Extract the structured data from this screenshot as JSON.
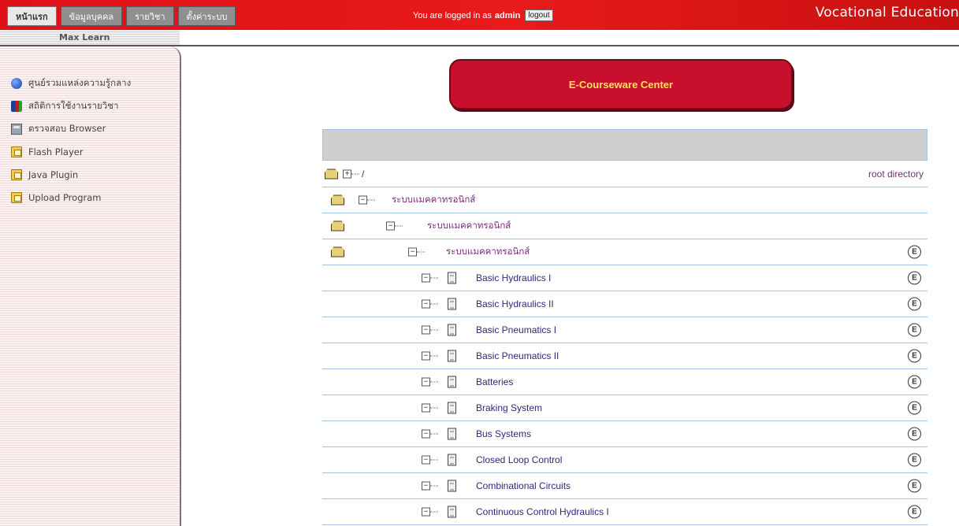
{
  "topbar": {
    "tabs": [
      "หน้าแรก",
      "ข้อมูลบุคคล",
      "รายวิชา",
      "ตั้งค่าระบบ"
    ],
    "login_prefix": "You are logged in as",
    "login_user": "admin",
    "logout_label": "logout",
    "brand": "Vocational Education"
  },
  "subbar": {
    "label": "Max Learn"
  },
  "sidebar": {
    "items": [
      {
        "label": "ศูนย์รวมแหล่งความรู้กลาง",
        "icon": "globe-icon"
      },
      {
        "label": "สถิติการใช้งานรายวิชา",
        "icon": "books-icon"
      },
      {
        "label": "ตรวจสอบ Browser",
        "icon": "calculator-icon"
      },
      {
        "label": "Flash Player",
        "icon": "folder-icon"
      },
      {
        "label": "Java Plugin",
        "icon": "folder-icon"
      },
      {
        "label": "Upload Program",
        "icon": "folder-icon"
      }
    ]
  },
  "main": {
    "center_button": "E-Courseware Center",
    "root": {
      "path": "/",
      "label": "root directory"
    },
    "folders": [
      "ระบบแมคคาทรอนิกส์",
      "ระบบแมคคาทรอนิกส์",
      "ระบบแมคคาทรอนิกส์"
    ],
    "e_label": "E",
    "courses": [
      "Basic Hydraulics I",
      "Basic Hydraulics II",
      "Basic Pneumatics I",
      "Basic Pneumatics II",
      "Batteries",
      "Braking System",
      "Bus Systems",
      "Closed Loop Control",
      "Combinational Circuits",
      "Continuous Control Hydraulics I"
    ]
  }
}
